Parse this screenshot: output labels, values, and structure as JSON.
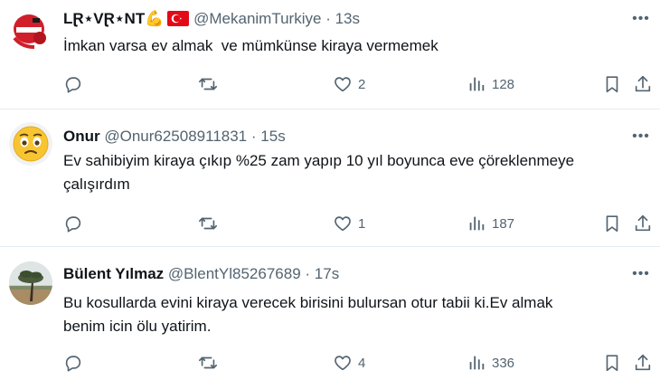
{
  "tweets": [
    {
      "display_name": "LⱤ⋆VⱤ⋆NT💪",
      "handle": "@MekanimTurkiye",
      "time": "13s",
      "text": "İmkan varsa ev almak  ve mümkünse kiraya vermemek",
      "replies": "",
      "retweets": "",
      "likes": "2",
      "views": "128",
      "avatar": "red-helmet-avatar",
      "badge": "turkey-flag-icon"
    },
    {
      "display_name": "Onur",
      "handle": "@Onur62508911831",
      "time": "15s",
      "text": "Ev sahibiyim kiraya çıkıp %25 zam yapıp 10 yıl boyunca eve çöreklenmeye\nçalışırdım",
      "replies": "",
      "retweets": "",
      "likes": "1",
      "views": "187",
      "avatar": "worried-face-emoji-avatar"
    },
    {
      "display_name": "Bülent Yılmaz",
      "handle": "@BlentYl85267689",
      "time": "17s",
      "text": "Bu kosullarda evini kiraya verecek birisini bulursan otur tabii ki.Ev almak\nbenim icin ölu yatirim.",
      "replies": "",
      "retweets": "",
      "likes": "4",
      "views": "336",
      "avatar": "tree-landscape-avatar"
    }
  ],
  "separator": "·",
  "colors": {
    "text": "#0f1419",
    "secondary": "#536471",
    "divider": "#e6ecf0",
    "flag_red": "#e30a17"
  }
}
